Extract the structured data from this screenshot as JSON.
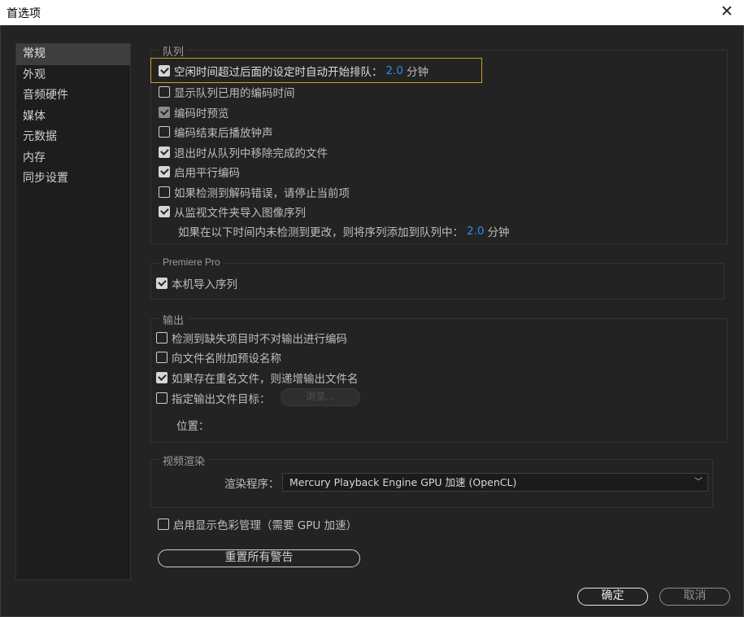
{
  "window": {
    "title": "首选项",
    "close_glyph": "✕"
  },
  "sidebar": {
    "items": [
      {
        "label": "常规",
        "active": true
      },
      {
        "label": "外观"
      },
      {
        "label": "音频硬件"
      },
      {
        "label": "媒体"
      },
      {
        "label": "元数据"
      },
      {
        "label": "内存"
      },
      {
        "label": "同步设置"
      }
    ]
  },
  "queue": {
    "legend": "队列",
    "idle_auto_start": {
      "label": "空闲时间超过后面的设定时自动开始排队：",
      "value": "2.0",
      "unit": "分钟",
      "checked": true
    },
    "show_elapsed": {
      "label": "显示队列已用的编码时间",
      "checked": false
    },
    "preview_while_encoding": {
      "label": "编码时预览",
      "checked": true
    },
    "chime_after_encoding": {
      "label": "编码结束后播放钟声",
      "checked": false
    },
    "remove_completed_on_exit": {
      "label": "退出时从队列中移除完成的文件",
      "checked": true
    },
    "parallel_encoding": {
      "label": "启用平行编码",
      "checked": true
    },
    "stop_on_decode_error": {
      "label": "如果检测到解码错误，请停止当前项",
      "checked": false
    },
    "import_image_sequence": {
      "label": "从监视文件夹导入图像序列",
      "checked": true
    },
    "no_change_timeout": {
      "label": "如果在以下时间内未检测到更改，则将序列添加到队列中：",
      "value": "2.0",
      "unit": "分钟"
    }
  },
  "premiere": {
    "legend": "Premiere Pro",
    "native_import": {
      "label": "本机导入序列",
      "checked": true
    }
  },
  "output": {
    "legend": "输出",
    "skip_missing": {
      "label": "检测到缺失项目时不对输出进行编码",
      "checked": false
    },
    "append_preset": {
      "label": "向文件名附加预设名称",
      "checked": false
    },
    "increment_name": {
      "label": "如果存在重名文件，则递增输出文件名",
      "checked": true
    },
    "specify_target": {
      "label": "指定输出文件目标：",
      "checked": false
    },
    "browse_label": "浏览...",
    "location_label": "位置："
  },
  "render": {
    "legend": "视频渲染",
    "renderer_label": "渲染程序：",
    "renderer_value": "Mercury Playback Engine GPU 加速 (OpenCL)"
  },
  "color_management": {
    "label": "启用显示色彩管理（需要 GPU 加速）",
    "checked": false
  },
  "reset_warnings_label": "重置所有警告",
  "footer": {
    "ok_label": "确定",
    "cancel_label": "取消"
  },
  "colors": {
    "accent": "#2d8ceb",
    "focus": "#c8a12a",
    "background": "#232323"
  }
}
